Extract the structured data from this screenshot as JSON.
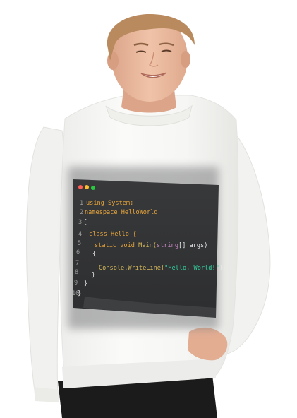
{
  "colors": {
    "background": "#ffffff",
    "sweatshirt": "#f7f7f5",
    "sweatshirt_shadow": "#e3e3e0",
    "skin": "#e9b79b",
    "hair": "#b98a5e",
    "pants": "#1b1b1b",
    "panel": "#333436",
    "keyword": "#e6a53c",
    "type": "#c586c0",
    "method": "#d7b85a",
    "plain": "#e8e8e8",
    "string": "#33d0a0",
    "gutter": "#9a9a9a",
    "dot_red": "#ff5f56",
    "dot_yellow": "#ffbd2e",
    "dot_green": "#27c93f"
  },
  "print": {
    "window_dots": [
      "close-dot",
      "minimize-dot",
      "maximize-dot"
    ],
    "line_numbers": [
      "1",
      "2",
      "3",
      "4",
      "5",
      "6",
      "7",
      "8",
      "9",
      "10"
    ],
    "code": {
      "l1_kw": "using",
      "l1_rest": " System;",
      "l2_kw": "namespace",
      "l2_rest": " HelloWorld",
      "l3": "{",
      "l4_kw": "class",
      "l4_rest": " Hello {",
      "l5_kw": "static void",
      "l5_method": " Main(",
      "l5_type": "string",
      "l5_rest": "[] args)",
      "l6": "{",
      "l7_obj": "Console.WriteLine(",
      "l7_str": "\"Hello, World!\"",
      "l7_end": ");",
      "l8": "}",
      "l9": "}",
      "l10": "}"
    }
  }
}
